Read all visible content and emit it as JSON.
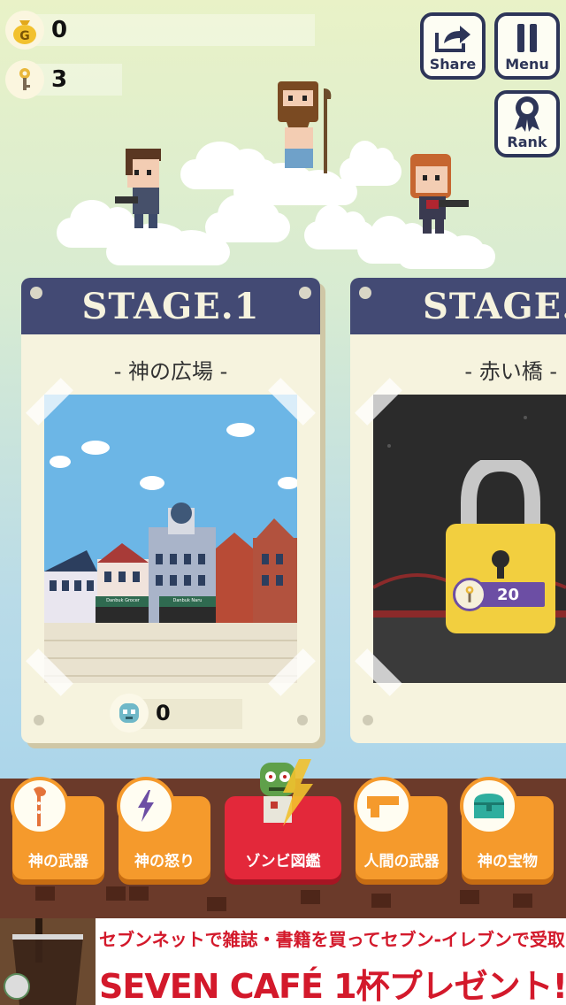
{
  "hud": {
    "gold": "0",
    "keys": "3"
  },
  "top_buttons": {
    "share": "Share",
    "menu": "Menu",
    "rank": "Rank"
  },
  "stages": [
    {
      "title": "STAGE.1",
      "name": "- 神の広場 -",
      "zombie_count": "0"
    },
    {
      "title": "STAGE.",
      "name": "- 赤い橋 -",
      "unlock_cost": "20"
    }
  ],
  "stage1_shop_signs": [
    "Danbuk Grocer",
    "Danbuk Naru"
  ],
  "bottom_menu": [
    {
      "label": "神の武器",
      "icon": "staff-icon"
    },
    {
      "label": "神の怒り",
      "icon": "lightning-icon"
    },
    {
      "label": "ゾンビ図鑑",
      "icon": "zombie-icon",
      "active": true
    },
    {
      "label": "人間の武器",
      "icon": "gun-icon"
    },
    {
      "label": "神の宝物",
      "icon": "treasure-chest-icon"
    }
  ],
  "ad": {
    "line1": "セブンネットで雑誌・書籍を買ってセブン-イレブンで受取ると",
    "line2": "SEVEN CAFÉ 1杯プレゼント!"
  },
  "colors": {
    "header_navy": "#434a74",
    "menu_orange": "#f59a2c",
    "menu_active_red": "#e3283a",
    "lock_yellow": "#f2cf3f",
    "price_purple": "#6c4ea4",
    "ad_red": "#d3192b"
  }
}
